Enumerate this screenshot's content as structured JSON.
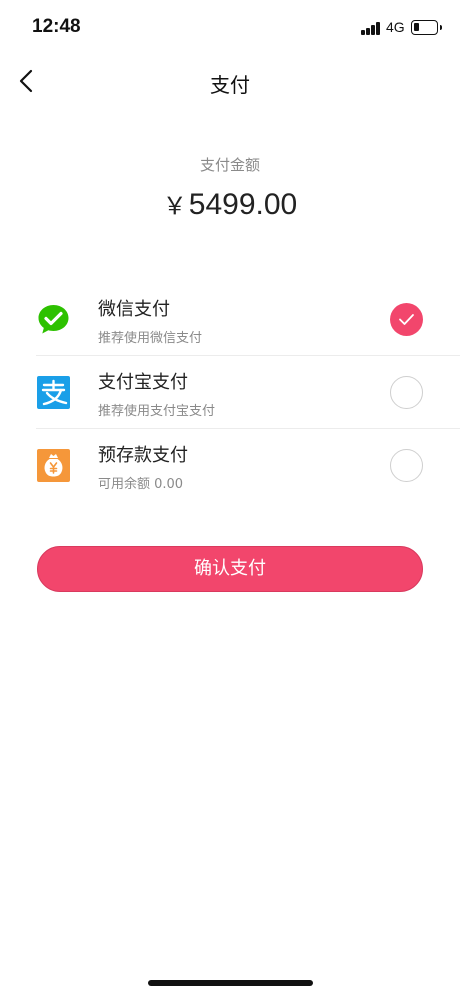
{
  "status_bar": {
    "time": "12:48",
    "network": "4G"
  },
  "nav": {
    "title": "支付",
    "back_icon": "chevron-left-icon"
  },
  "amount": {
    "label": "支付金额",
    "currency": "￥",
    "value": "5499.00"
  },
  "payment_methods": [
    {
      "title": "微信支付",
      "subtitle": "推荐使用微信支付",
      "icon": "wechat-pay-icon",
      "icon_color": "#2dc100",
      "selected": true
    },
    {
      "title": "支付宝支付",
      "subtitle": "推荐使用支付宝支付",
      "icon": "alipay-icon",
      "icon_color": "#1a9fe8",
      "selected": false
    },
    {
      "title": "预存款支付",
      "subtitle": "可用余额 0.00",
      "icon": "deposit-wallet-icon",
      "icon_color": "#f5973a",
      "selected": false
    }
  ],
  "confirm_button": {
    "label": "确认支付"
  },
  "colors": {
    "accent": "#f2466c",
    "secondary_text": "#8a8a8a"
  }
}
